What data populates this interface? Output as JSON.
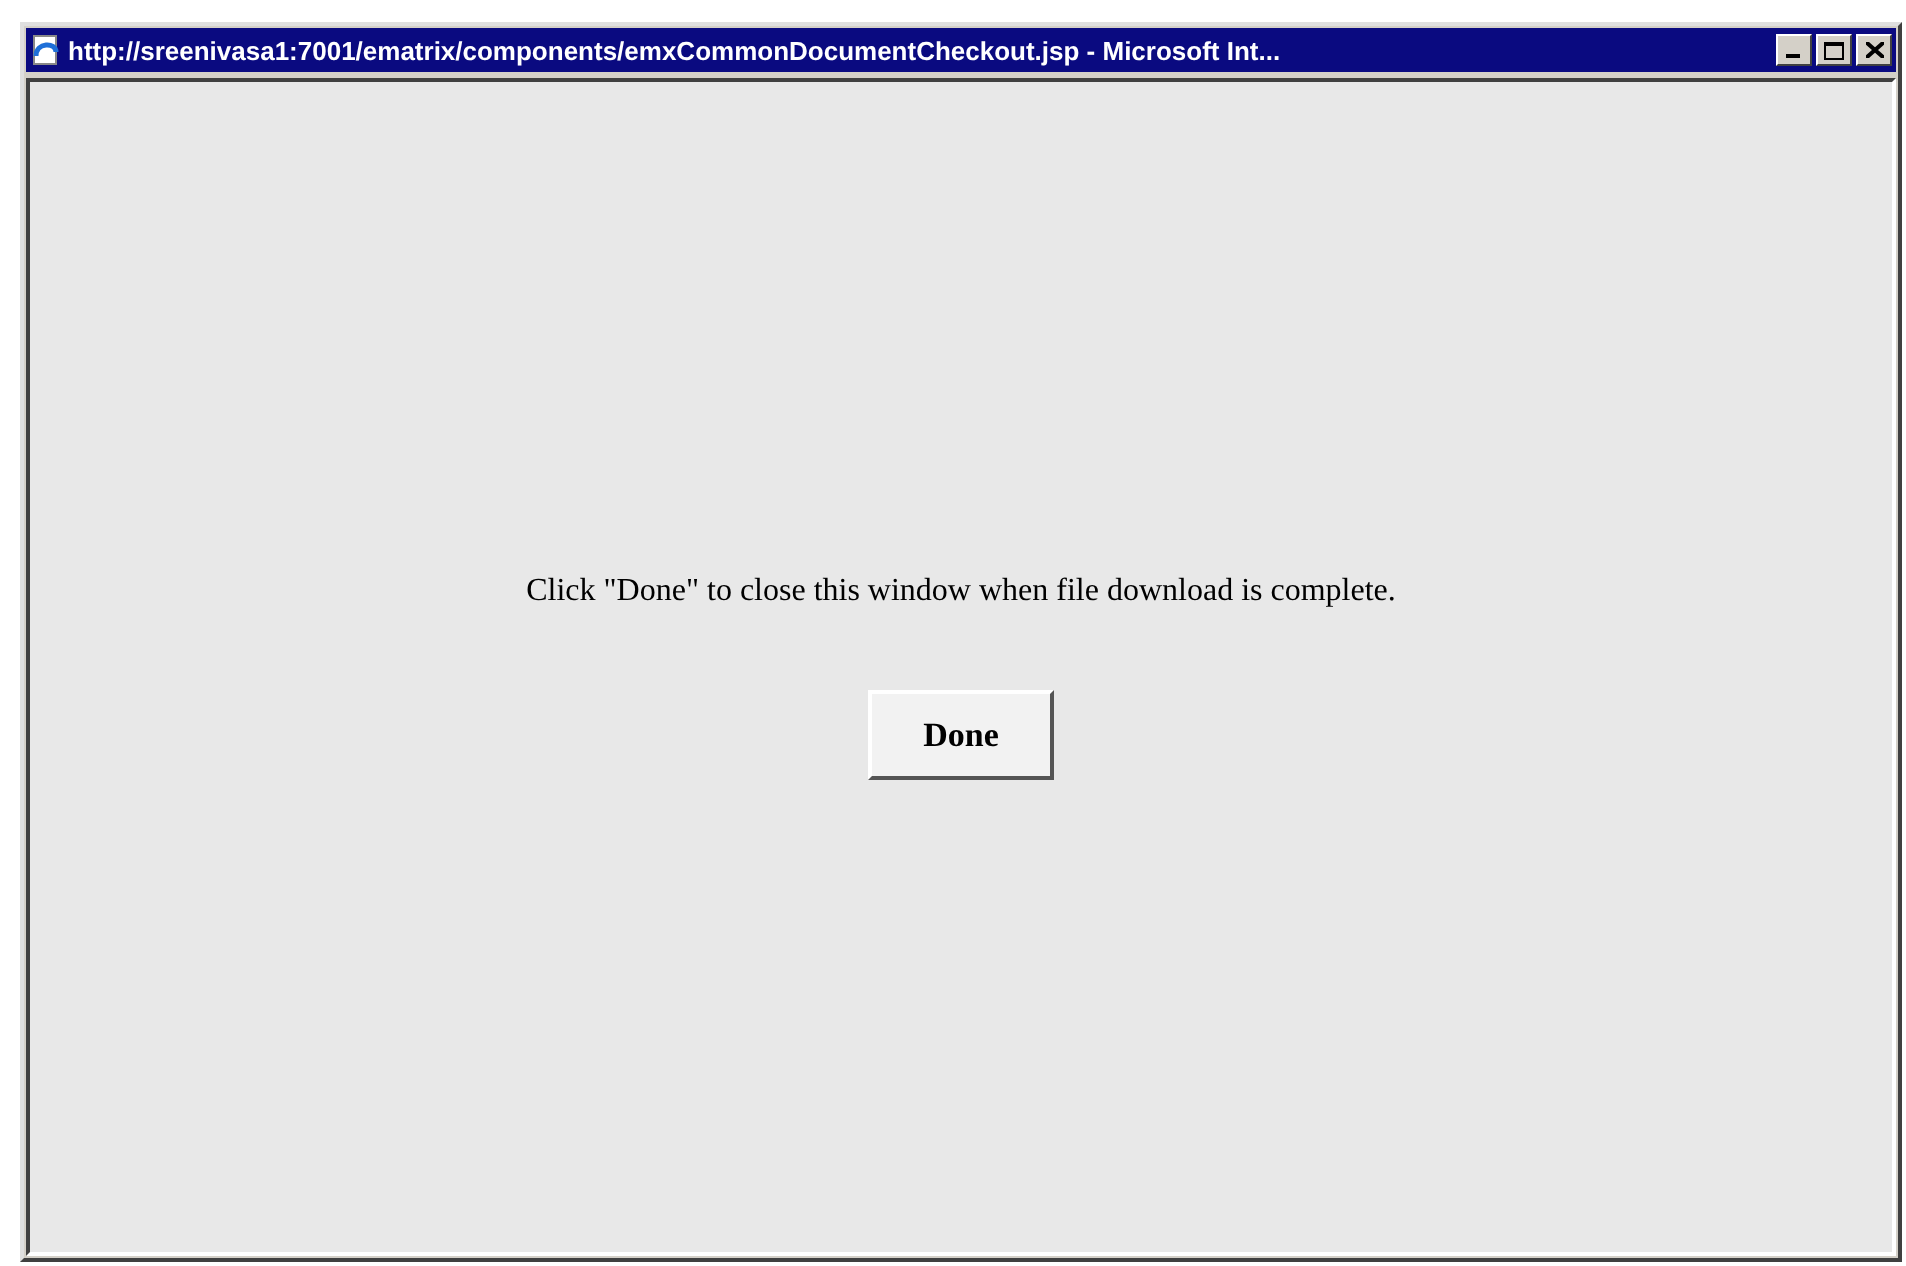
{
  "window": {
    "title": "http://sreenivasa1:7001/ematrix/components/emxCommonDocumentCheckout.jsp - Microsoft Int..."
  },
  "content": {
    "message": "Click \"Done\" to close this window when file download is complete.",
    "button": "Done"
  }
}
